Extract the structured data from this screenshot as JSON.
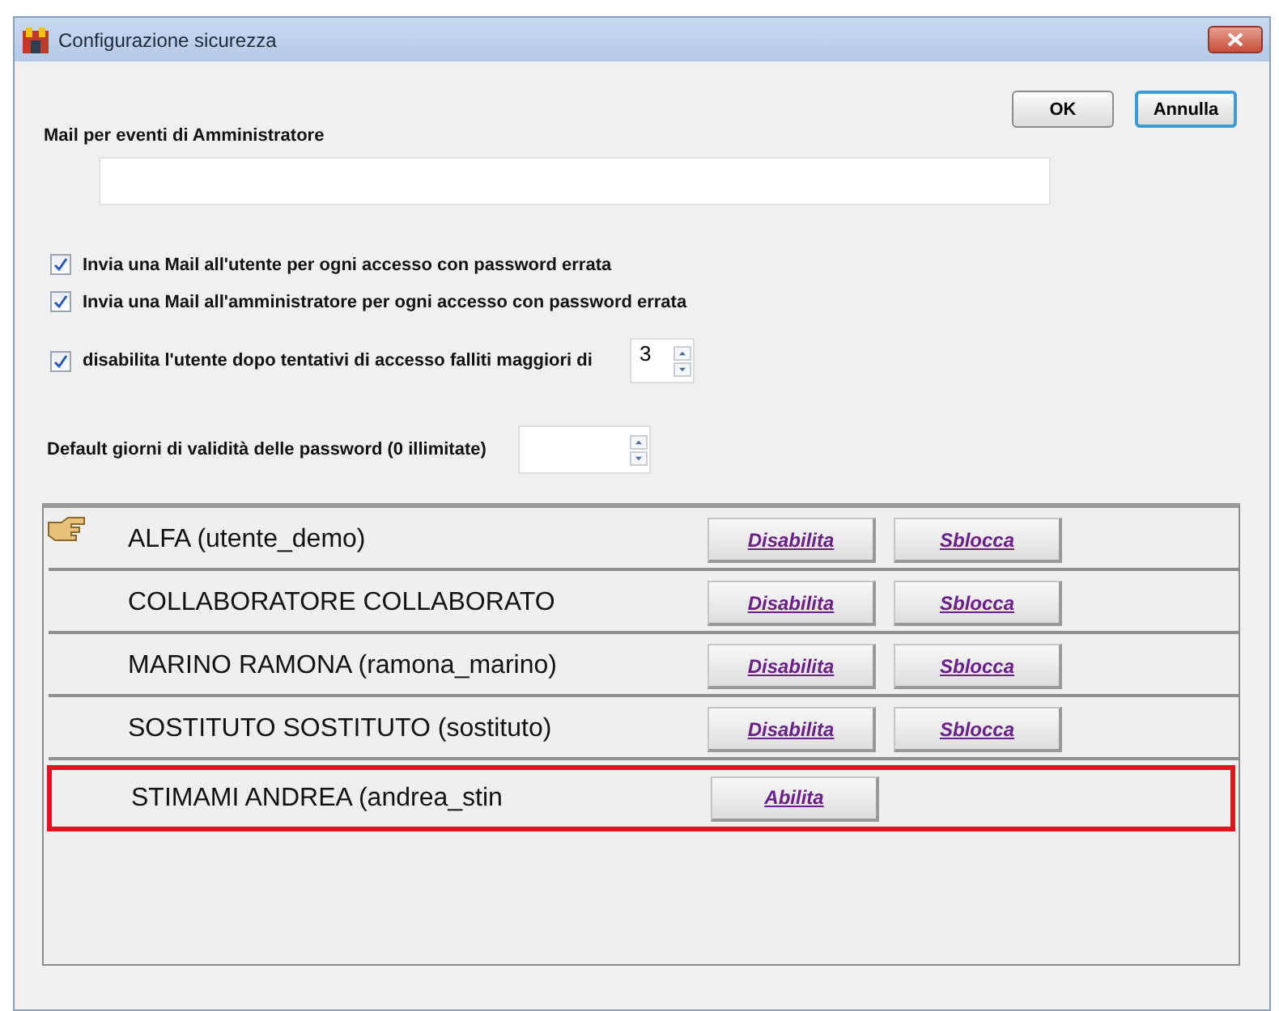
{
  "window": {
    "title": "Configurazione sicurezza"
  },
  "buttons": [
    "OK",
    "Annulla"
  ],
  "admin_mail": {
    "label": "Mail per eventi di Amministratore"
  },
  "options": [
    {
      "label": "Invia una Mail all'utente per ogni accesso con password errata",
      "checked": true
    },
    {
      "label": "Invia una Mail all'amministratore per ogni accesso con password errata",
      "checked": true
    },
    {
      "label": "disabilita l'utente dopo tentativi di accesso falliti maggiori di",
      "checked": true,
      "value": "3"
    }
  ],
  "password_validity": {
    "label": "Default giorni di validità delle password (0 illimitate)"
  },
  "users": [
    {
      "name": "ALFA (utente_demo)",
      "current": true,
      "highlighted": false,
      "actions": [
        "Disabilita",
        "Sblocca"
      ]
    },
    {
      "name": "COLLABORATORE COLLABORATO",
      "current": false,
      "highlighted": false,
      "actions": [
        "Disabilita",
        "Sblocca"
      ]
    },
    {
      "name": "MARINO RAMONA (ramona_marino)",
      "current": false,
      "highlighted": false,
      "actions": [
        "Disabilita",
        "Sblocca"
      ]
    },
    {
      "name": "SOSTITUTO SOSTITUTO (sostituto)",
      "current": false,
      "highlighted": false,
      "actions": [
        "Disabilita",
        "Sblocca"
      ]
    },
    {
      "name": "STIMAMI ANDREA (andrea_stin",
      "current": false,
      "highlighted": true,
      "actions": [
        "Abilita"
      ]
    }
  ]
}
